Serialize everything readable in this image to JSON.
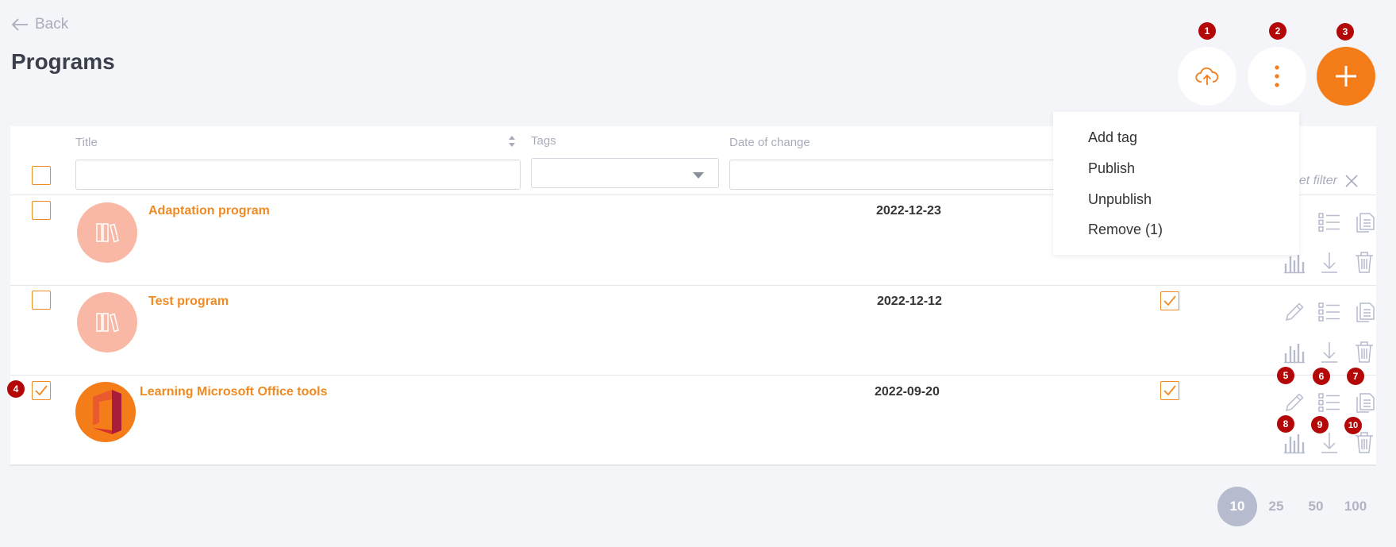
{
  "header": {
    "back_label": "Back",
    "title": "Programs"
  },
  "badges": [
    "1",
    "2",
    "3",
    "4",
    "5",
    "6",
    "7",
    "8",
    "9",
    "10"
  ],
  "table": {
    "columns": {
      "title": "Title",
      "tags": "Tags",
      "date": "Date of change"
    },
    "reset_filter": "eset filter",
    "rows": [
      {
        "title": "Adaptation program",
        "date": "2022-12-23",
        "published": false,
        "selected": false,
        "avatar": "books-icon"
      },
      {
        "title": "Test program",
        "date": "2022-12-12",
        "published": true,
        "selected": false,
        "avatar": "books-icon"
      },
      {
        "title": "Learning Microsoft Office tools",
        "date": "2022-09-20",
        "published": true,
        "selected": true,
        "avatar": "office-logo"
      }
    ]
  },
  "menu": {
    "items": [
      "Add tag",
      "Publish",
      "Unpublish",
      "Remove (1)"
    ]
  },
  "pagination": {
    "sizes": [
      "10",
      "25",
      "50",
      "100"
    ],
    "active": "10"
  },
  "colors": {
    "accent": "#f47d1a",
    "badge": "#b40808",
    "muted": "#a9adbb"
  }
}
